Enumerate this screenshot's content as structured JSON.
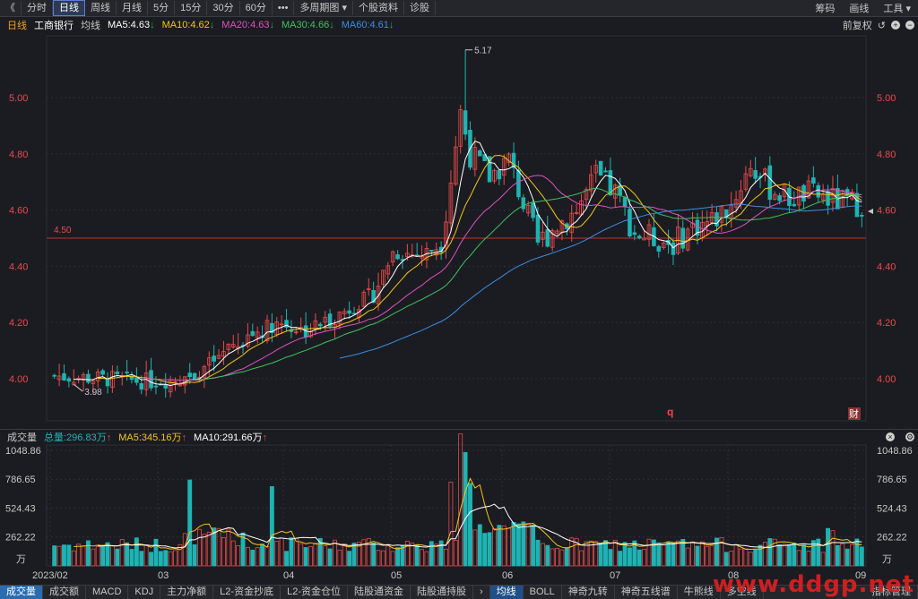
{
  "toolbar": {
    "back": "《",
    "tabs": [
      "分时",
      "日线",
      "周线",
      "月线",
      "5分",
      "15分",
      "30分",
      "60分",
      "•••",
      "多周期图 ▾",
      "个股资料",
      "诊股"
    ],
    "active_tab": "日线",
    "right": [
      "筹码",
      "画线",
      "工具 ▾"
    ]
  },
  "ma_bar": {
    "period": "日线",
    "name": "工商银行",
    "avg": "均线",
    "ma5": "MA5:4.63",
    "ma10": "MA10:4.62",
    "ma20": "MA20:4.63",
    "ma30": "MA30:4.66",
    "ma60": "MA60:4.61",
    "adj": "前复权",
    "icons": [
      "↺",
      "+",
      "−"
    ]
  },
  "colors": {
    "up": "#e84a4a",
    "down": "#1fb3b3",
    "ma5": "#ffffff",
    "ma10": "#f5c518",
    "ma20": "#e050c0",
    "ma30": "#40c060",
    "ma60": "#3a8ee6",
    "grid": "#2c2e35",
    "hline": "#c03030"
  },
  "price_axis": {
    "ticks": [
      "5.00",
      "4.80",
      "4.60",
      "4.40",
      "4.20",
      "4.00"
    ]
  },
  "annotations": {
    "high": "5.17",
    "low": "3.98",
    "hline_label": "4.50",
    "q_mark": "q",
    "cai_mark": "财"
  },
  "vol_bar": {
    "title": "成交量",
    "total": "总量:296.83万",
    "ma5": "MA5:345.16万",
    "ma10": "MA10:291.66万"
  },
  "vol_axis": {
    "ticks": [
      "1048.86",
      "786.65",
      "524.43",
      "262.22"
    ],
    "unit": "万"
  },
  "x_axis": {
    "labels": [
      "2023/02",
      "03",
      "04",
      "05",
      "06",
      "07",
      "08",
      "09"
    ]
  },
  "bottom_tabs": [
    "成交量",
    "成交额",
    "MACD",
    "KDJ",
    "主力净额",
    "L2-资金抄底",
    "L2-资金仓位",
    "陆股通资金",
    "陆股通持股",
    "均线",
    "BOLL",
    "神奇九转",
    "神奇五线谱",
    "牛熊线",
    "多空线",
    "指标管理"
  ],
  "watermark": "www.ddgp.net",
  "chart_data": {
    "type": "line",
    "title": "工商银行 日线",
    "x": [
      "2023/02",
      "03",
      "04",
      "05",
      "06",
      "07",
      "08",
      "09"
    ],
    "series": [
      {
        "name": "MA5",
        "values": [
          4.02,
          4.1,
          4.3,
          4.75,
          4.58,
          4.52,
          4.64,
          4.63
        ]
      },
      {
        "name": "MA10",
        "values": [
          4.02,
          4.07,
          4.27,
          4.72,
          4.6,
          4.53,
          4.63,
          4.62
        ]
      },
      {
        "name": "MA20",
        "values": [
          4.02,
          4.05,
          4.24,
          4.62,
          4.64,
          4.54,
          4.61,
          4.63
        ]
      },
      {
        "name": "MA30",
        "values": [
          4.02,
          4.04,
          4.2,
          4.55,
          4.63,
          4.55,
          4.6,
          4.66
        ]
      },
      {
        "name": "MA60",
        "values": [
          3.96,
          4.0,
          4.12,
          4.38,
          4.53,
          4.57,
          4.6,
          4.61
        ]
      }
    ],
    "ylim": [
      3.9,
      5.2
    ],
    "volume": {
      "values": [
        180,
        200,
        420,
        260,
        1048,
        260,
        240,
        300
      ],
      "ylim": [
        0,
        1048.86
      ]
    }
  }
}
